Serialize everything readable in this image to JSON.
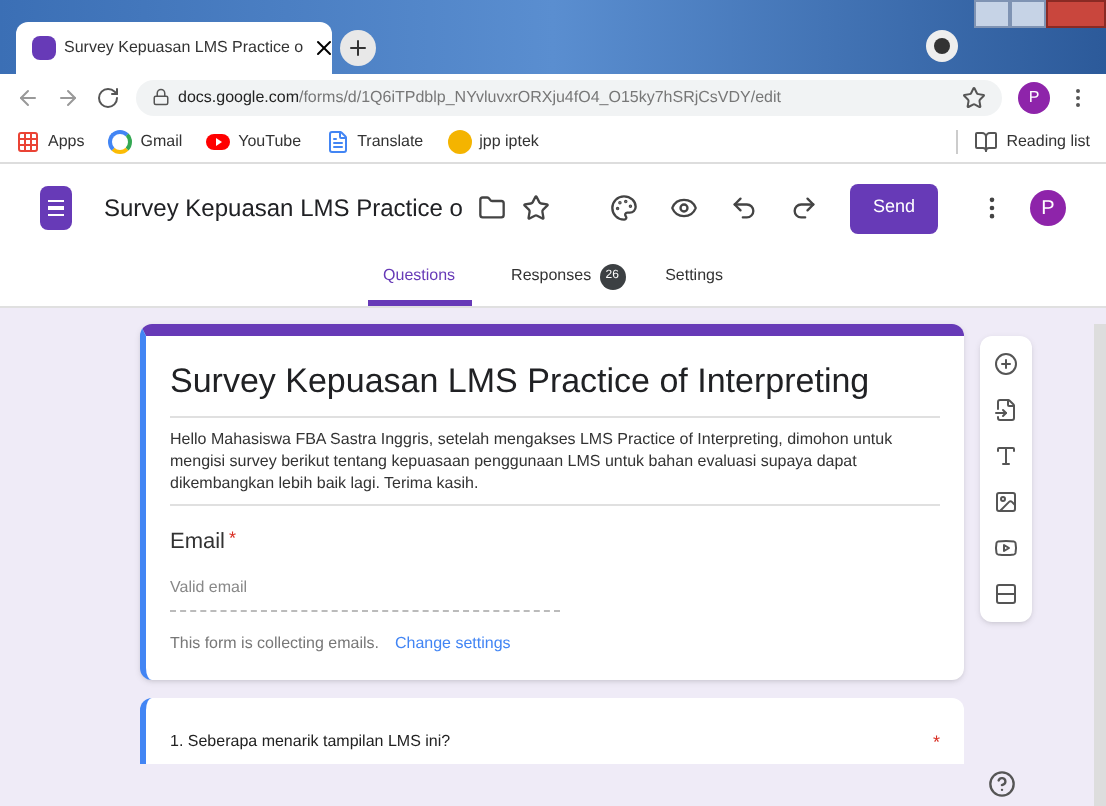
{
  "browser": {
    "tab_title": "Survey Kepuasan LMS Practice o",
    "url_host": "docs.google.com",
    "url_path": "/forms/d/1Q6iTPdblp_NYvluvxrORXju4fO4_O15ky7hSRjCsVDY/edit",
    "profile": "P",
    "bookmarks": [
      {
        "kind": "apps",
        "label": "Apps"
      },
      {
        "kind": "gmail",
        "label": "Gmail"
      },
      {
        "kind": "youtube",
        "label": "YouTube"
      },
      {
        "kind": "translate",
        "label": "Translate"
      },
      {
        "kind": "link",
        "label": "jpp iptek"
      }
    ],
    "reading_list": "Reading list"
  },
  "header": {
    "title": "Survey Kepuasan LMS Practice o",
    "send": "Send",
    "avatar": "P"
  },
  "tabs": [
    {
      "label": "Questions",
      "selected": true
    },
    {
      "label": "Responses",
      "selected": false,
      "badge": "26"
    },
    {
      "label": "Settings",
      "selected": false
    }
  ],
  "form": {
    "title": "Survey Kepuasan LMS Practice of Interpreting",
    "description": "Hello Mahasiswa FBA Sastra Inggris, setelah mengakses LMS Practice of Interpreting, dimohon untuk mengisi survey berikut tentang kepuasaan penggunaan LMS untuk bahan evaluasi supaya dapat dikembangkan lebih baik lagi. Terima kasih.",
    "email": {
      "label": "Email",
      "required_mark": "*",
      "placeholder": "Valid email"
    },
    "note": "This form is collecting emails.",
    "link": "Change settings"
  },
  "question": {
    "text": "1. Seberapa menarik tampilan LMS ini?",
    "required_mark": "*"
  }
}
